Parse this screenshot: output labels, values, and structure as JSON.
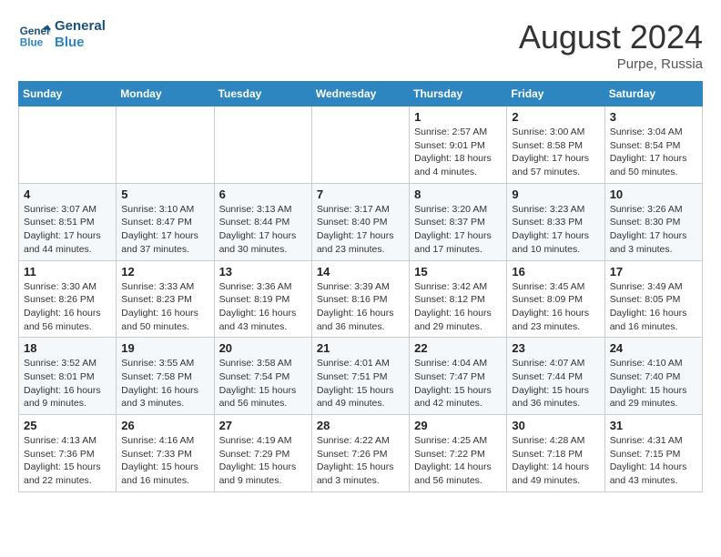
{
  "logo": {
    "line1": "General",
    "line2": "Blue"
  },
  "title": "August 2024",
  "location": "Purpe, Russia",
  "days_header": [
    "Sunday",
    "Monday",
    "Tuesday",
    "Wednesday",
    "Thursday",
    "Friday",
    "Saturday"
  ],
  "weeks": [
    [
      {
        "day": "",
        "info": ""
      },
      {
        "day": "",
        "info": ""
      },
      {
        "day": "",
        "info": ""
      },
      {
        "day": "",
        "info": ""
      },
      {
        "day": "1",
        "info": "Sunrise: 2:57 AM\nSunset: 9:01 PM\nDaylight: 18 hours and 4 minutes."
      },
      {
        "day": "2",
        "info": "Sunrise: 3:00 AM\nSunset: 8:58 PM\nDaylight: 17 hours and 57 minutes."
      },
      {
        "day": "3",
        "info": "Sunrise: 3:04 AM\nSunset: 8:54 PM\nDaylight: 17 hours and 50 minutes."
      }
    ],
    [
      {
        "day": "4",
        "info": "Sunrise: 3:07 AM\nSunset: 8:51 PM\nDaylight: 17 hours and 44 minutes."
      },
      {
        "day": "5",
        "info": "Sunrise: 3:10 AM\nSunset: 8:47 PM\nDaylight: 17 hours and 37 minutes."
      },
      {
        "day": "6",
        "info": "Sunrise: 3:13 AM\nSunset: 8:44 PM\nDaylight: 17 hours and 30 minutes."
      },
      {
        "day": "7",
        "info": "Sunrise: 3:17 AM\nSunset: 8:40 PM\nDaylight: 17 hours and 23 minutes."
      },
      {
        "day": "8",
        "info": "Sunrise: 3:20 AM\nSunset: 8:37 PM\nDaylight: 17 hours and 17 minutes."
      },
      {
        "day": "9",
        "info": "Sunrise: 3:23 AM\nSunset: 8:33 PM\nDaylight: 17 hours and 10 minutes."
      },
      {
        "day": "10",
        "info": "Sunrise: 3:26 AM\nSunset: 8:30 PM\nDaylight: 17 hours and 3 minutes."
      }
    ],
    [
      {
        "day": "11",
        "info": "Sunrise: 3:30 AM\nSunset: 8:26 PM\nDaylight: 16 hours and 56 minutes."
      },
      {
        "day": "12",
        "info": "Sunrise: 3:33 AM\nSunset: 8:23 PM\nDaylight: 16 hours and 50 minutes."
      },
      {
        "day": "13",
        "info": "Sunrise: 3:36 AM\nSunset: 8:19 PM\nDaylight: 16 hours and 43 minutes."
      },
      {
        "day": "14",
        "info": "Sunrise: 3:39 AM\nSunset: 8:16 PM\nDaylight: 16 hours and 36 minutes."
      },
      {
        "day": "15",
        "info": "Sunrise: 3:42 AM\nSunset: 8:12 PM\nDaylight: 16 hours and 29 minutes."
      },
      {
        "day": "16",
        "info": "Sunrise: 3:45 AM\nSunset: 8:09 PM\nDaylight: 16 hours and 23 minutes."
      },
      {
        "day": "17",
        "info": "Sunrise: 3:49 AM\nSunset: 8:05 PM\nDaylight: 16 hours and 16 minutes."
      }
    ],
    [
      {
        "day": "18",
        "info": "Sunrise: 3:52 AM\nSunset: 8:01 PM\nDaylight: 16 hours and 9 minutes."
      },
      {
        "day": "19",
        "info": "Sunrise: 3:55 AM\nSunset: 7:58 PM\nDaylight: 16 hours and 3 minutes."
      },
      {
        "day": "20",
        "info": "Sunrise: 3:58 AM\nSunset: 7:54 PM\nDaylight: 15 hours and 56 minutes."
      },
      {
        "day": "21",
        "info": "Sunrise: 4:01 AM\nSunset: 7:51 PM\nDaylight: 15 hours and 49 minutes."
      },
      {
        "day": "22",
        "info": "Sunrise: 4:04 AM\nSunset: 7:47 PM\nDaylight: 15 hours and 42 minutes."
      },
      {
        "day": "23",
        "info": "Sunrise: 4:07 AM\nSunset: 7:44 PM\nDaylight: 15 hours and 36 minutes."
      },
      {
        "day": "24",
        "info": "Sunrise: 4:10 AM\nSunset: 7:40 PM\nDaylight: 15 hours and 29 minutes."
      }
    ],
    [
      {
        "day": "25",
        "info": "Sunrise: 4:13 AM\nSunset: 7:36 PM\nDaylight: 15 hours and 22 minutes."
      },
      {
        "day": "26",
        "info": "Sunrise: 4:16 AM\nSunset: 7:33 PM\nDaylight: 15 hours and 16 minutes."
      },
      {
        "day": "27",
        "info": "Sunrise: 4:19 AM\nSunset: 7:29 PM\nDaylight: 15 hours and 9 minutes."
      },
      {
        "day": "28",
        "info": "Sunrise: 4:22 AM\nSunset: 7:26 PM\nDaylight: 15 hours and 3 minutes."
      },
      {
        "day": "29",
        "info": "Sunrise: 4:25 AM\nSunset: 7:22 PM\nDaylight: 14 hours and 56 minutes."
      },
      {
        "day": "30",
        "info": "Sunrise: 4:28 AM\nSunset: 7:18 PM\nDaylight: 14 hours and 49 minutes."
      },
      {
        "day": "31",
        "info": "Sunrise: 4:31 AM\nSunset: 7:15 PM\nDaylight: 14 hours and 43 minutes."
      }
    ]
  ]
}
